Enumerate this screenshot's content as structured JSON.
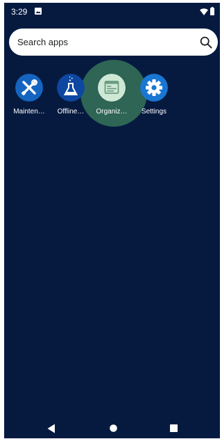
{
  "status_bar": {
    "time": "3:29",
    "icons": [
      "image-notification-icon",
      "wifi-icon",
      "battery-icon"
    ]
  },
  "search": {
    "placeholder": "Search apps",
    "icon": "search-icon"
  },
  "apps": [
    {
      "label": "Mainten…",
      "icon": "wrench-screwdriver-icon",
      "color": "#1565c0"
    },
    {
      "label": "Offline…",
      "icon": "flask-icon",
      "color": "#0d47a1"
    },
    {
      "label": "Organiz…",
      "icon": "organizer-window-icon",
      "color": "#cfe8d6",
      "pressed": true
    },
    {
      "label": "Settings",
      "icon": "gear-icon",
      "color": "#1976d2"
    }
  ],
  "navigation": {
    "buttons": [
      "back",
      "home",
      "recents"
    ]
  },
  "colors": {
    "background": "#061a40",
    "search_bar": "#ffffff",
    "pressed_ripple": "#3a7b5a"
  }
}
